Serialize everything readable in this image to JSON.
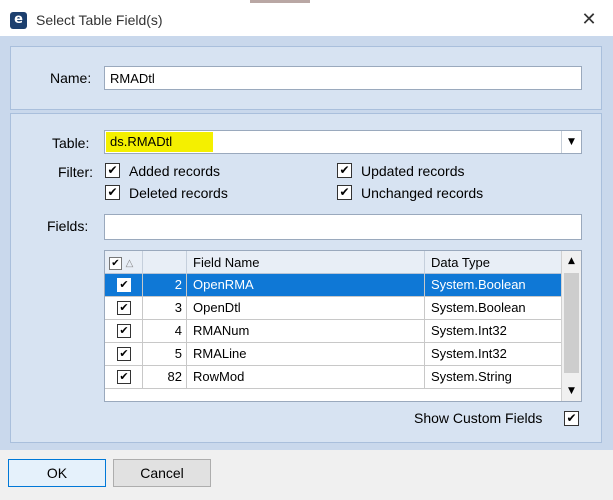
{
  "window": {
    "title": "Select Table Field(s)",
    "app_icon_letter": "e",
    "close_glyph": "✕"
  },
  "name_field": {
    "label": "Name:",
    "value": "RMADtl"
  },
  "table_field": {
    "label": "Table:",
    "value": "ds.RMADtl",
    "dropdown_glyph": "▼"
  },
  "filter": {
    "label": "Filter:",
    "options": [
      {
        "label": "Added records",
        "checked": true
      },
      {
        "label": "Deleted records",
        "checked": true
      },
      {
        "label": "Updated records",
        "checked": true
      },
      {
        "label": "Unchanged records",
        "checked": true
      }
    ]
  },
  "fields_filter": {
    "label": "Fields:",
    "value": ""
  },
  "grid": {
    "columns": [
      "",
      "",
      "Field Name",
      "Data Type"
    ],
    "sort_glyph": "△",
    "rows": [
      {
        "checked": true,
        "index": "2",
        "field_name": "OpenRMA",
        "data_type": "System.Boolean",
        "selected": true
      },
      {
        "checked": true,
        "index": "3",
        "field_name": "OpenDtl",
        "data_type": "System.Boolean",
        "selected": false
      },
      {
        "checked": true,
        "index": "4",
        "field_name": "RMANum",
        "data_type": "System.Int32",
        "selected": false
      },
      {
        "checked": true,
        "index": "5",
        "field_name": "RMALine",
        "data_type": "System.Int32",
        "selected": false
      },
      {
        "checked": true,
        "index": "82",
        "field_name": "RowMod",
        "data_type": "System.String",
        "selected": false
      }
    ],
    "scroll_up_glyph": "▲",
    "scroll_down_glyph": "▼"
  },
  "show_custom_fields": {
    "label": "Show Custom Fields",
    "checked": true
  },
  "check_glyph": "✔",
  "buttons": {
    "ok": "OK",
    "cancel": "Cancel"
  },
  "colors": {
    "highlight": "#f4f000",
    "selection": "#0f78d6",
    "panel": "#d7e3f2"
  }
}
